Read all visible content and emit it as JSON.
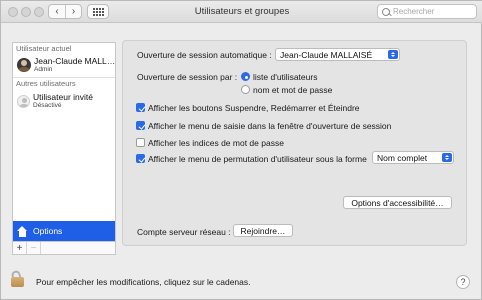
{
  "window": {
    "title": "Utilisateurs et groupes"
  },
  "toolbar": {
    "back": "‹",
    "forward": "›",
    "search_placeholder": "Rechercher"
  },
  "sidebar": {
    "current_header": "Utilisateur actuel",
    "current_user": {
      "name": "Jean-Claude MALLAISÉ",
      "role": "Admin"
    },
    "other_header": "Autres utilisateurs",
    "guest_user": {
      "name": "Utilisateur invité",
      "status": "Désactivé"
    },
    "options_label": "Options",
    "add": "+",
    "remove": "−"
  },
  "main": {
    "auto_login_label": "Ouverture de session automatique :",
    "auto_login_value": "Jean-Claude MALLAISÉ",
    "display_label": "Ouverture de session par :",
    "radio_list": "liste d'utilisateurs",
    "radio_name": "nom et mot de passe",
    "check_sleep": "Afficher les boutons Suspendre, Redémarrer et Éteindre",
    "check_input": "Afficher le menu de saisie dans la fenêtre d'ouverture de session",
    "check_hints": "Afficher les indices de mot de passe",
    "check_switch": "Afficher le menu de permutation d'utilisateur sous la forme",
    "switch_value": "Nom complet",
    "accessibility_button": "Options d'accessibilité…",
    "network_label": "Compte serveur réseau :",
    "join_button": "Rejoindre…"
  },
  "footer": {
    "lock_text": "Pour empêcher les modifications, cliquez sur le cadenas.",
    "help": "?"
  },
  "state": {
    "radio_list_selected": true,
    "check_sleep": true,
    "check_input": true,
    "check_hints": false,
    "check_switch": true
  }
}
